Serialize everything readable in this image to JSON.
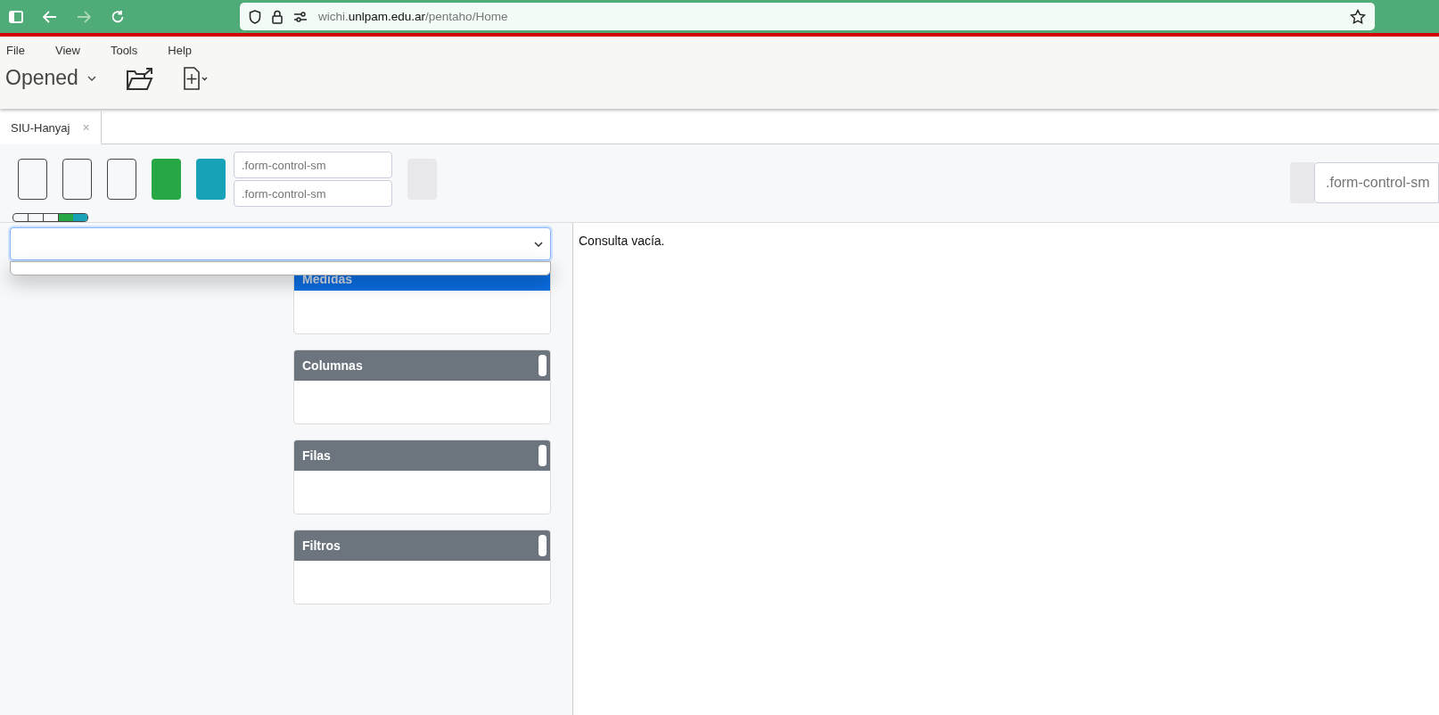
{
  "browser": {
    "url": "wichi.**unlpam.edu.ar**/pentaho/Home"
  },
  "menu": [
    "File",
    "View",
    "Tools",
    "Help"
  ],
  "perspective": {
    "label": "Opened"
  },
  "tabs": [
    {
      "label": "SIU-Hanyaj",
      "selected": true,
      "close": "×"
    }
  ],
  "toolbar": {
    "buttons": [
      {
        "kind": "outline"
      },
      {
        "kind": "outline"
      },
      {
        "kind": "outline"
      },
      {
        "kind": "filled",
        "color": "#28a745"
      },
      {
        "kind": "filled",
        "color": "#17a2b8"
      }
    ],
    "inputs": [
      {
        "placeholder": ".form-control-sm"
      },
      {
        "placeholder": ".form-control-sm"
      }
    ],
    "right_input": {
      "placeholder": ".form-control-sm"
    }
  },
  "cube_select": {
    "expanded": true
  },
  "panels": [
    {
      "title": "Medidas",
      "highlighted": true
    },
    {
      "title": "Columnas",
      "highlighted": false
    },
    {
      "title": "Filas",
      "highlighted": false
    },
    {
      "title": "Filtros",
      "highlighted": false
    }
  ],
  "result": {
    "message": "Consulta vacía."
  }
}
